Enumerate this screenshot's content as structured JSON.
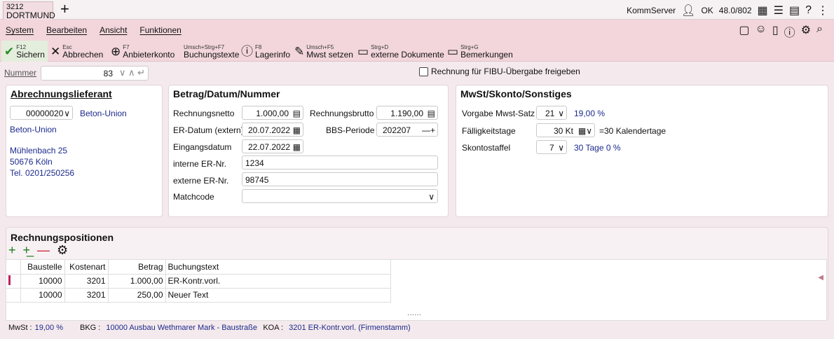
{
  "tab": {
    "number": "3212",
    "city": "DORTMUND"
  },
  "top_right": {
    "server": "KommServer",
    "status": "OK",
    "count": "48.0/802"
  },
  "menu": [
    "System",
    "Bearbeiten",
    "Ansicht",
    "Funktionen"
  ],
  "toolbar": [
    {
      "key": "F12",
      "label": "Sichern",
      "icon": "check-icon"
    },
    {
      "key": "Esc",
      "label": "Abbrechen",
      "icon": "close-icon"
    },
    {
      "key": "F7",
      "label": "Anbieterkonto",
      "icon": "plus-circle-icon"
    },
    {
      "key": "Umsch+Strg+F7",
      "label": "Buchungstexte",
      "icon": ""
    },
    {
      "key": "F8",
      "label": "Lagerinfo",
      "icon": "info-icon"
    },
    {
      "key": "Umsch+F5",
      "label": "Mwst setzen",
      "icon": "pencil-icon"
    },
    {
      "key": "Strg+D",
      "label": "externe Dokumente",
      "icon": "document-icon"
    },
    {
      "key": "Strg+G",
      "label": "Bemerkungen",
      "icon": "note-icon"
    }
  ],
  "nummer": {
    "label": "Nummer",
    "value": "83"
  },
  "fibu_checkbox": {
    "label": "Rechnung für FIBU-Übergabe freigeben",
    "checked": false
  },
  "supplier": {
    "title": "Abrechnungslieferant",
    "code": "00000020",
    "short": "Beton-Union",
    "name": "Beton-Union",
    "street": "Mühlenbach 25",
    "city": "50676 Köln",
    "phone": "Tel. 0201/250256"
  },
  "betrag": {
    "title": "Betrag/Datum/Nummer",
    "netto_label": "Rechnungsnetto",
    "netto": "1.000,00",
    "brutto_label": "Rechnungsbrutto",
    "brutto": "1.190,00",
    "erdatum_label": "ER-Datum (extern)",
    "erdatum": "20.07.2022",
    "bbs_label": "BBS-Periode",
    "bbs": "202207",
    "eingang_label": "Eingangsdatum",
    "eingang": "22.07.2022",
    "intern_label": "interne ER-Nr.",
    "intern": "1234",
    "extern_label": "externe ER-Nr.",
    "extern": "98745",
    "match_label": "Matchcode",
    "match": ""
  },
  "mwst": {
    "title": "MwSt/Skonto/Sonstiges",
    "vorgabe_label": "Vorgabe Mwst-Satz",
    "vorgabe": "21",
    "vorgabe_pct": "19,00 %",
    "faellig_label": "Fälligkeitstage",
    "faellig": "30 Kt",
    "faellig_note": "=30 Kalendertage",
    "skonto_label": "Skontostaffel",
    "skonto": "7",
    "skonto_note": "30 Tage 0 %"
  },
  "positions": {
    "title": "Rechnungspositionen",
    "columns": [
      "Baustelle",
      "Kostenart",
      "Betrag",
      "Buchungstext"
    ],
    "rows": [
      [
        "10000",
        "3201",
        "1.000,00",
        "ER-Kontr.vorl."
      ],
      [
        "10000",
        "3201",
        "250,00",
        "Neuer Text"
      ]
    ]
  },
  "status": {
    "mwst_label": "MwSt :",
    "mwst": "19,00 %",
    "bkg_label": "BKG :",
    "bkg": "10000 Ausbau Wethmarer Mark - Baustraße",
    "koa_label": "KOA :",
    "koa": "3201 ER-Kontr.vorl. (Firmenstamm)"
  },
  "colors": {
    "accent": "#f2d6dc",
    "link_blue": "#1c2a8c",
    "save_green": "#2a8a2a"
  }
}
